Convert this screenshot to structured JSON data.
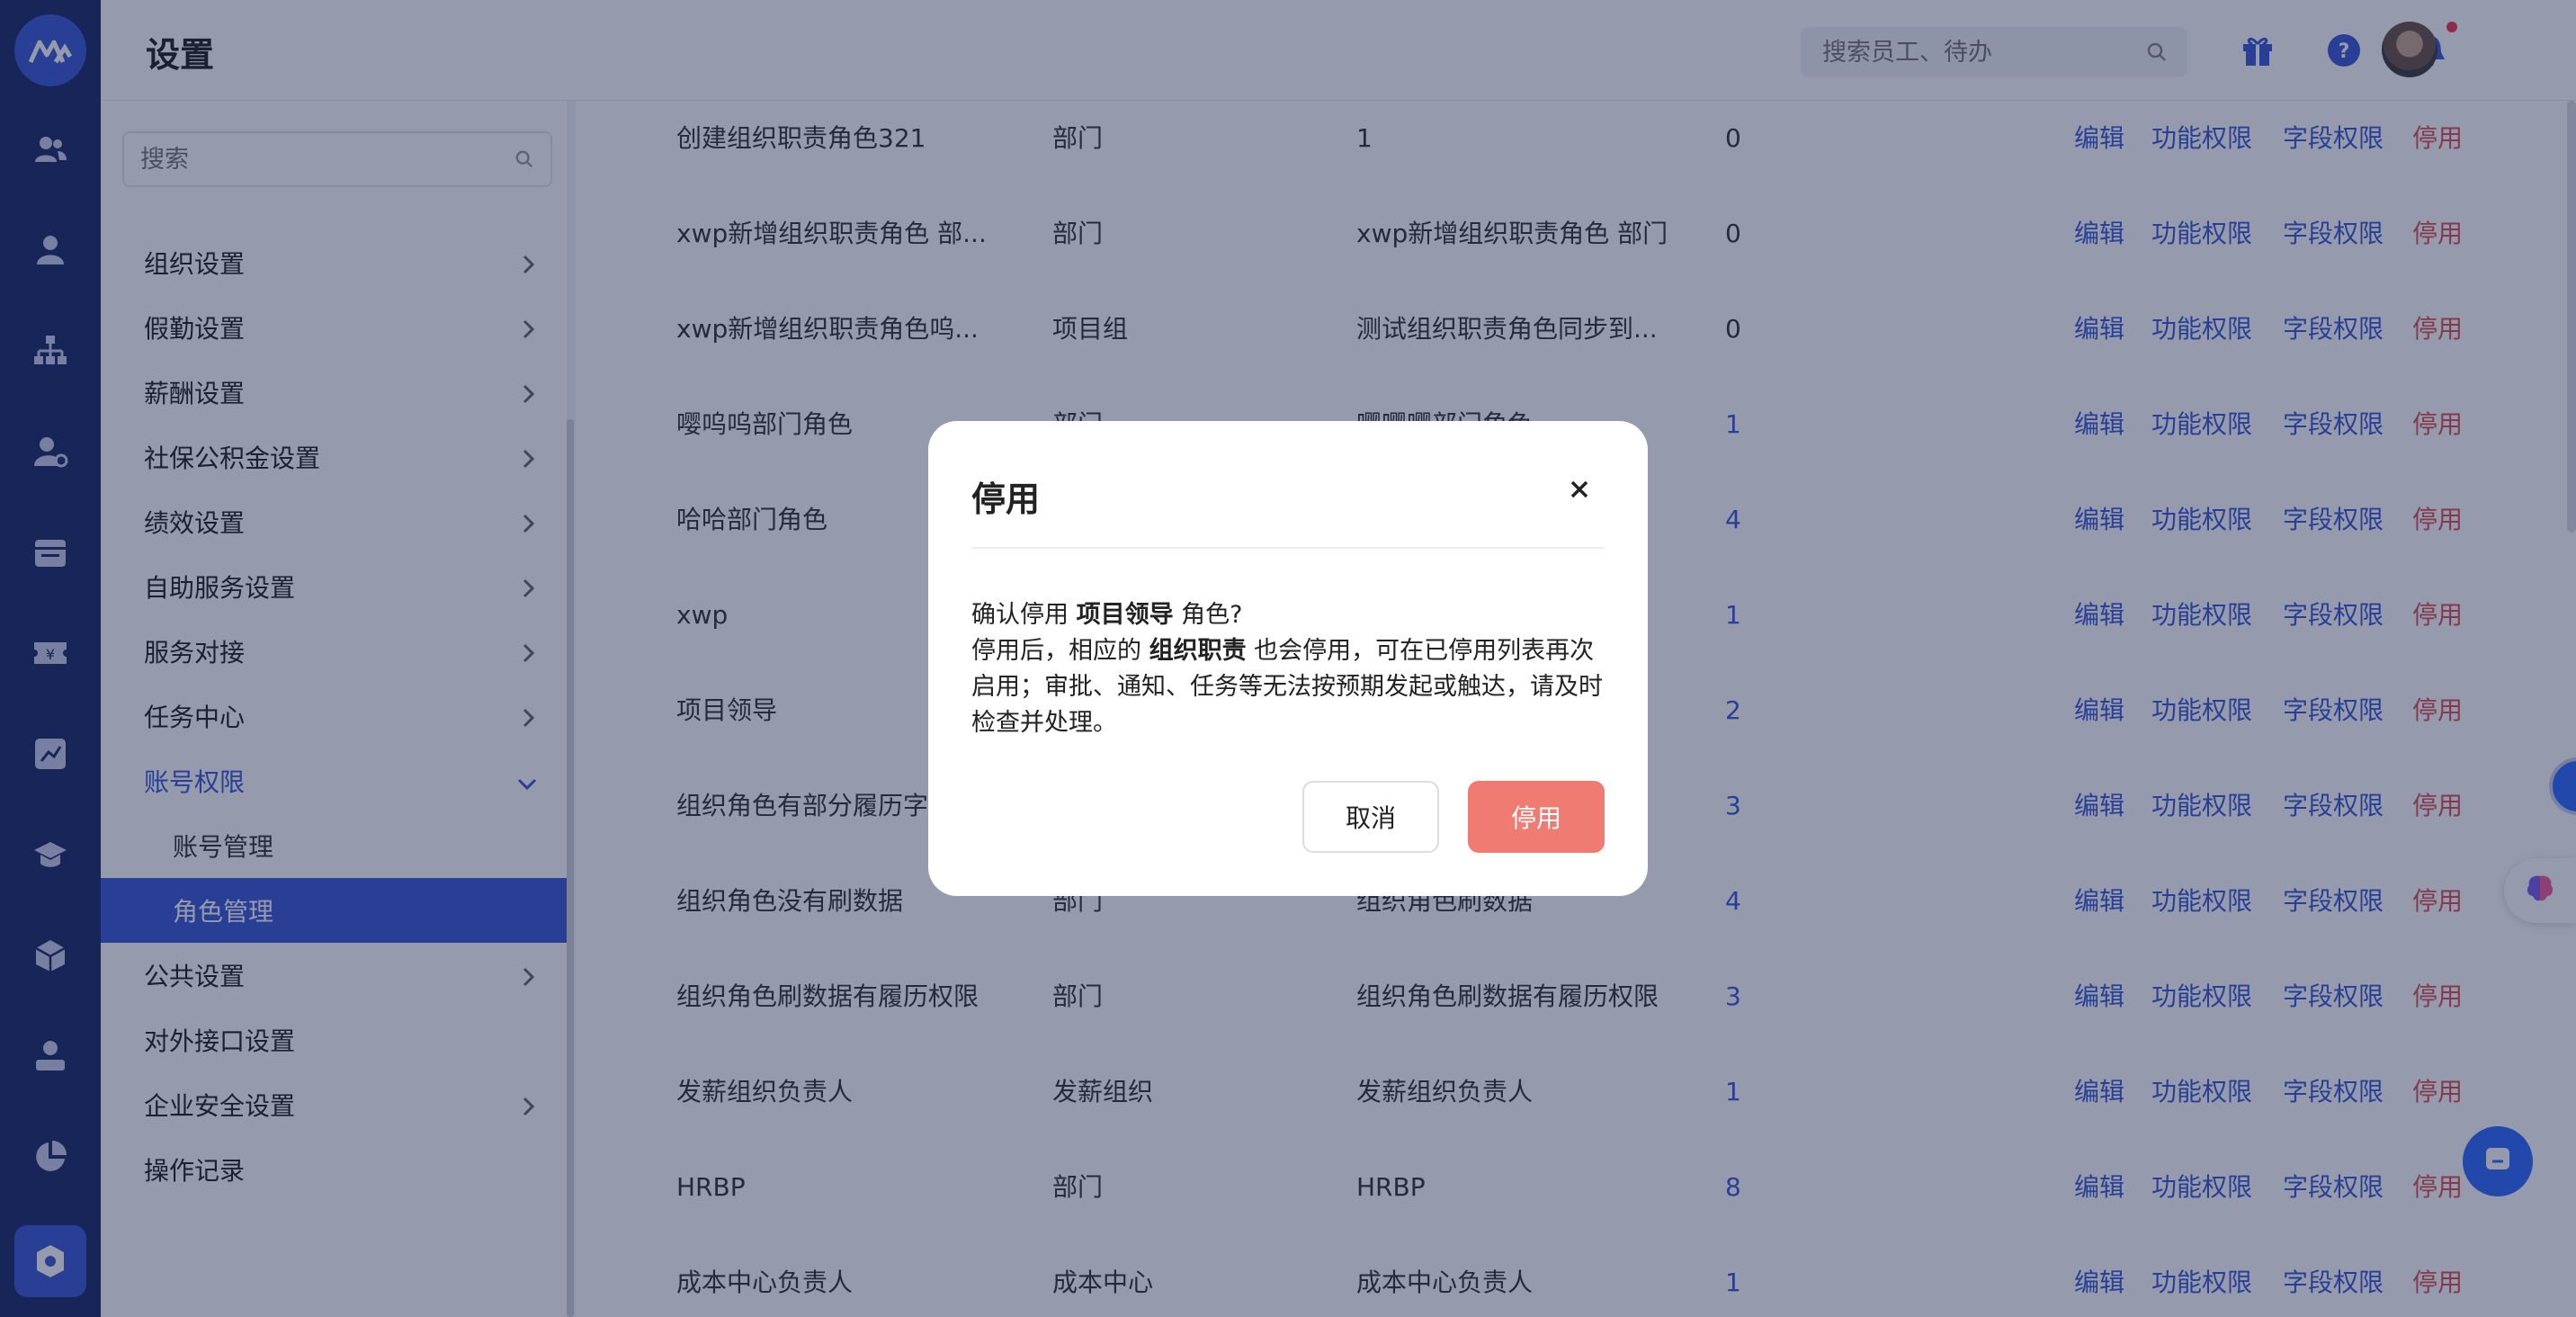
{
  "header": {
    "title": "设置",
    "search_placeholder": "搜索员工、待办"
  },
  "sidebar": {
    "search_placeholder": "搜索",
    "items": [
      {
        "label": "组织设置",
        "chevron": "right"
      },
      {
        "label": "假勤设置",
        "chevron": "right"
      },
      {
        "label": "薪酬设置",
        "chevron": "right"
      },
      {
        "label": "社保公积金设置",
        "chevron": "right"
      },
      {
        "label": "绩效设置",
        "chevron": "right"
      },
      {
        "label": "自助服务设置",
        "chevron": "right"
      },
      {
        "label": "服务对接",
        "chevron": "right"
      },
      {
        "label": "任务中心",
        "chevron": "right"
      },
      {
        "label": "账号权限",
        "chevron": "down",
        "children": [
          {
            "label": "账号管理"
          },
          {
            "label": "角色管理",
            "selected": true
          }
        ]
      },
      {
        "label": "公共设置",
        "chevron": "right"
      },
      {
        "label": "对外接口设置",
        "chevron": "none"
      },
      {
        "label": "企业安全设置",
        "chevron": "right"
      },
      {
        "label": "操作记录",
        "chevron": "none"
      }
    ]
  },
  "table": {
    "actions": {
      "edit": "编辑",
      "func": "功能权限",
      "field": "字段权限",
      "stop": "停用"
    },
    "rows": [
      {
        "name": "创建组织职责角色321",
        "type": "部门",
        "desc": "1",
        "count": "0"
      },
      {
        "name": "xwp新增组织职责角色 部...",
        "type": "部门",
        "desc": "xwp新增组织职责角色 部门",
        "count": "0"
      },
      {
        "name": "xwp新增组织职责角色呜...",
        "type": "项目组",
        "desc": "测试组织职责角色同步到...",
        "count": "0"
      },
      {
        "name": "嘤呜呜部门角色",
        "type": "部门",
        "desc": "嘤嘤嘤部门角色",
        "count": "1"
      },
      {
        "name": "哈哈部门角色",
        "type": "",
        "desc": "",
        "count": "4"
      },
      {
        "name": "xwp",
        "type": "",
        "desc": "",
        "count": "1"
      },
      {
        "name": "项目领导",
        "type": "",
        "desc": "",
        "count": "2"
      },
      {
        "name": "组织角色有部分履历字",
        "type": "",
        "desc": "",
        "count": "3"
      },
      {
        "name": "组织角色没有刷数据",
        "type": "部门",
        "desc": "组织角色刷数据",
        "count": "4"
      },
      {
        "name": "组织角色刷数据有履历权限",
        "type": "部门",
        "desc": "组织角色刷数据有履历权限",
        "count": "3"
      },
      {
        "name": "发薪组织负责人",
        "type": "发薪组织",
        "desc": "发薪组织负责人",
        "count": "1"
      },
      {
        "name": "HRBP",
        "type": "部门",
        "desc": "HRBP",
        "count": "8"
      },
      {
        "name": "成本中心负责人",
        "type": "成本中心",
        "desc": "成本中心负责人",
        "count": "1"
      }
    ]
  },
  "modal": {
    "title": "停用",
    "line1_prefix": "确认停用 ",
    "line1_role": "项目领导",
    "line1_suffix": " 角色?",
    "line2_prefix": "停用后，相应的 ",
    "line2_bold": "组织职责",
    "line2_suffix": " 也会停用，可在已停用列表再次启用；审批、通知、任务等无法按预期发起或触达，请及时检查并处理。",
    "cancel_label": "取消",
    "confirm_label": "停用"
  },
  "colors": {
    "rail": "#1a2a66",
    "accent": "#3a5ad6",
    "danger": "#e05050",
    "confirm_button": "#ef7b73"
  },
  "icons": {
    "rail": [
      "logo-icon",
      "team-icon",
      "person-icon",
      "org-chart-icon",
      "user-settings-icon",
      "calendar-icon",
      "payroll-icon",
      "chart-icon",
      "education-icon",
      "cube-icon",
      "user-badge-icon",
      "pie-chart-icon",
      "settings-icon"
    ],
    "header": [
      "gift-icon",
      "help-icon",
      "bell-icon"
    ]
  }
}
